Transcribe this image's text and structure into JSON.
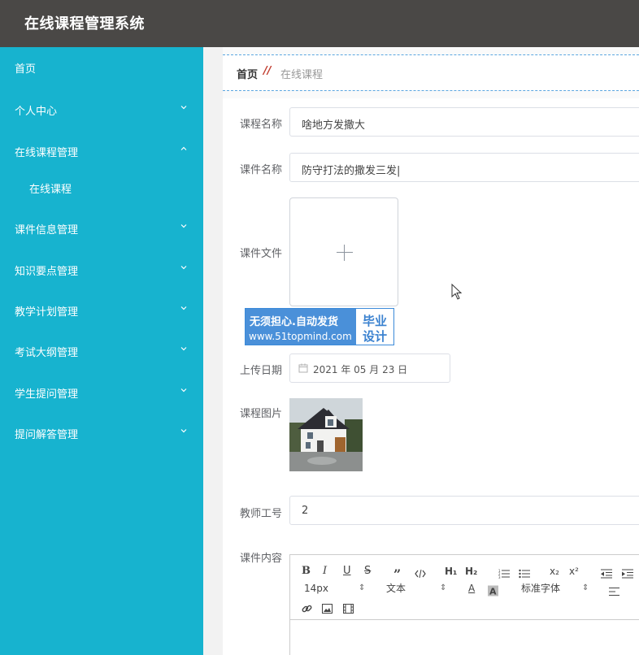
{
  "app": {
    "title": "在线课程管理系统"
  },
  "sidebar": {
    "items": [
      {
        "label": "首页",
        "chevron": "none"
      },
      {
        "label": "个人中心",
        "chevron": "down"
      },
      {
        "label": "在线课程管理",
        "chevron": "up"
      },
      {
        "label": "在线课程",
        "chevron": "none",
        "sub": true
      },
      {
        "label": "课件信息管理",
        "chevron": "down"
      },
      {
        "label": "知识要点管理",
        "chevron": "down"
      },
      {
        "label": "教学计划管理",
        "chevron": "down"
      },
      {
        "label": "考试大纲管理",
        "chevron": "down"
      },
      {
        "label": "学生提问管理",
        "chevron": "down"
      },
      {
        "label": "提问解答管理",
        "chevron": "down"
      }
    ]
  },
  "breadcrumb": {
    "home": "首页",
    "separator": "//",
    "current": "在线课程"
  },
  "form": {
    "course_name_label": "课程名称",
    "course_name_value": "啥地方发撒大",
    "courseware_name_label": "课件名称",
    "courseware_name_value": "防守打法的撒发三发|",
    "courseware_file_label": "课件文件",
    "upload_date_label": "上传日期",
    "upload_date_value": "2021 年 05 月 23 日",
    "course_image_label": "课程图片",
    "teacher_id_label": "教师工号",
    "teacher_id_value": "2",
    "content_label": "课件内容"
  },
  "watermark": {
    "line1": "无须担心.自动发货",
    "line2": "www.51topmind.com",
    "right1": "毕业",
    "right2": "设计"
  },
  "editor": {
    "font_size": "14px",
    "paragraph": "文本",
    "font_family": "标准字体",
    "bold": "B",
    "italic": "I",
    "underline": "U",
    "strike": "S",
    "h1": "H₁",
    "h2": "H₂",
    "subscript": "x₂",
    "superscript": "x²",
    "font_color": "A"
  },
  "colors": {
    "topbar": "#4a4846",
    "sidebar": "#17b3cf",
    "breadcrumb_separator": "#c0392b",
    "watermark_blue": "#4a90d9"
  }
}
